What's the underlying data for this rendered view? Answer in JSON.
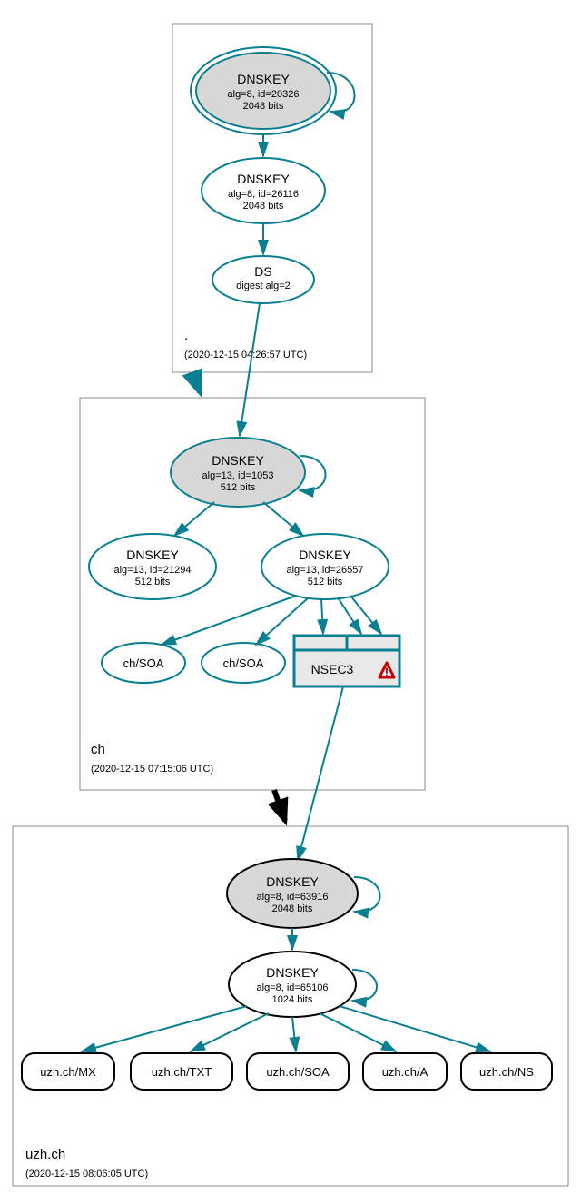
{
  "zones": {
    "root": {
      "label": ".",
      "timestamp": "(2020-12-15 04:26:57 UTC)",
      "dnskey1": {
        "title": "DNSKEY",
        "line2": "alg=8, id=20326",
        "line3": "2048 bits"
      },
      "dnskey2": {
        "title": "DNSKEY",
        "line2": "alg=8, id=26116",
        "line3": "2048 bits"
      },
      "ds": {
        "title": "DS",
        "line2": "digest alg=2"
      }
    },
    "ch": {
      "label": "ch",
      "timestamp": "(2020-12-15 07:15:06 UTC)",
      "dnskey1": {
        "title": "DNSKEY",
        "line2": "alg=13, id=1053",
        "line3": "512 bits"
      },
      "dnskey2": {
        "title": "DNSKEY",
        "line2": "alg=13, id=21294",
        "line3": "512 bits"
      },
      "dnskey3": {
        "title": "DNSKEY",
        "line2": "alg=13, id=26557",
        "line3": "512 bits"
      },
      "soa1": "ch/SOA",
      "soa2": "ch/SOA",
      "nsec3": "NSEC3"
    },
    "uzh": {
      "label": "uzh.ch",
      "timestamp": "(2020-12-15 08:06:05 UTC)",
      "dnskey1": {
        "title": "DNSKEY",
        "line2": "alg=8, id=63916",
        "line3": "2048 bits"
      },
      "dnskey2": {
        "title": "DNSKEY",
        "line2": "alg=8, id=65106",
        "line3": "1024 bits"
      },
      "rr": {
        "mx": "uzh.ch/MX",
        "txt": "uzh.ch/TXT",
        "soa": "uzh.ch/SOA",
        "a": "uzh.ch/A",
        "ns": "uzh.ch/NS"
      }
    }
  }
}
